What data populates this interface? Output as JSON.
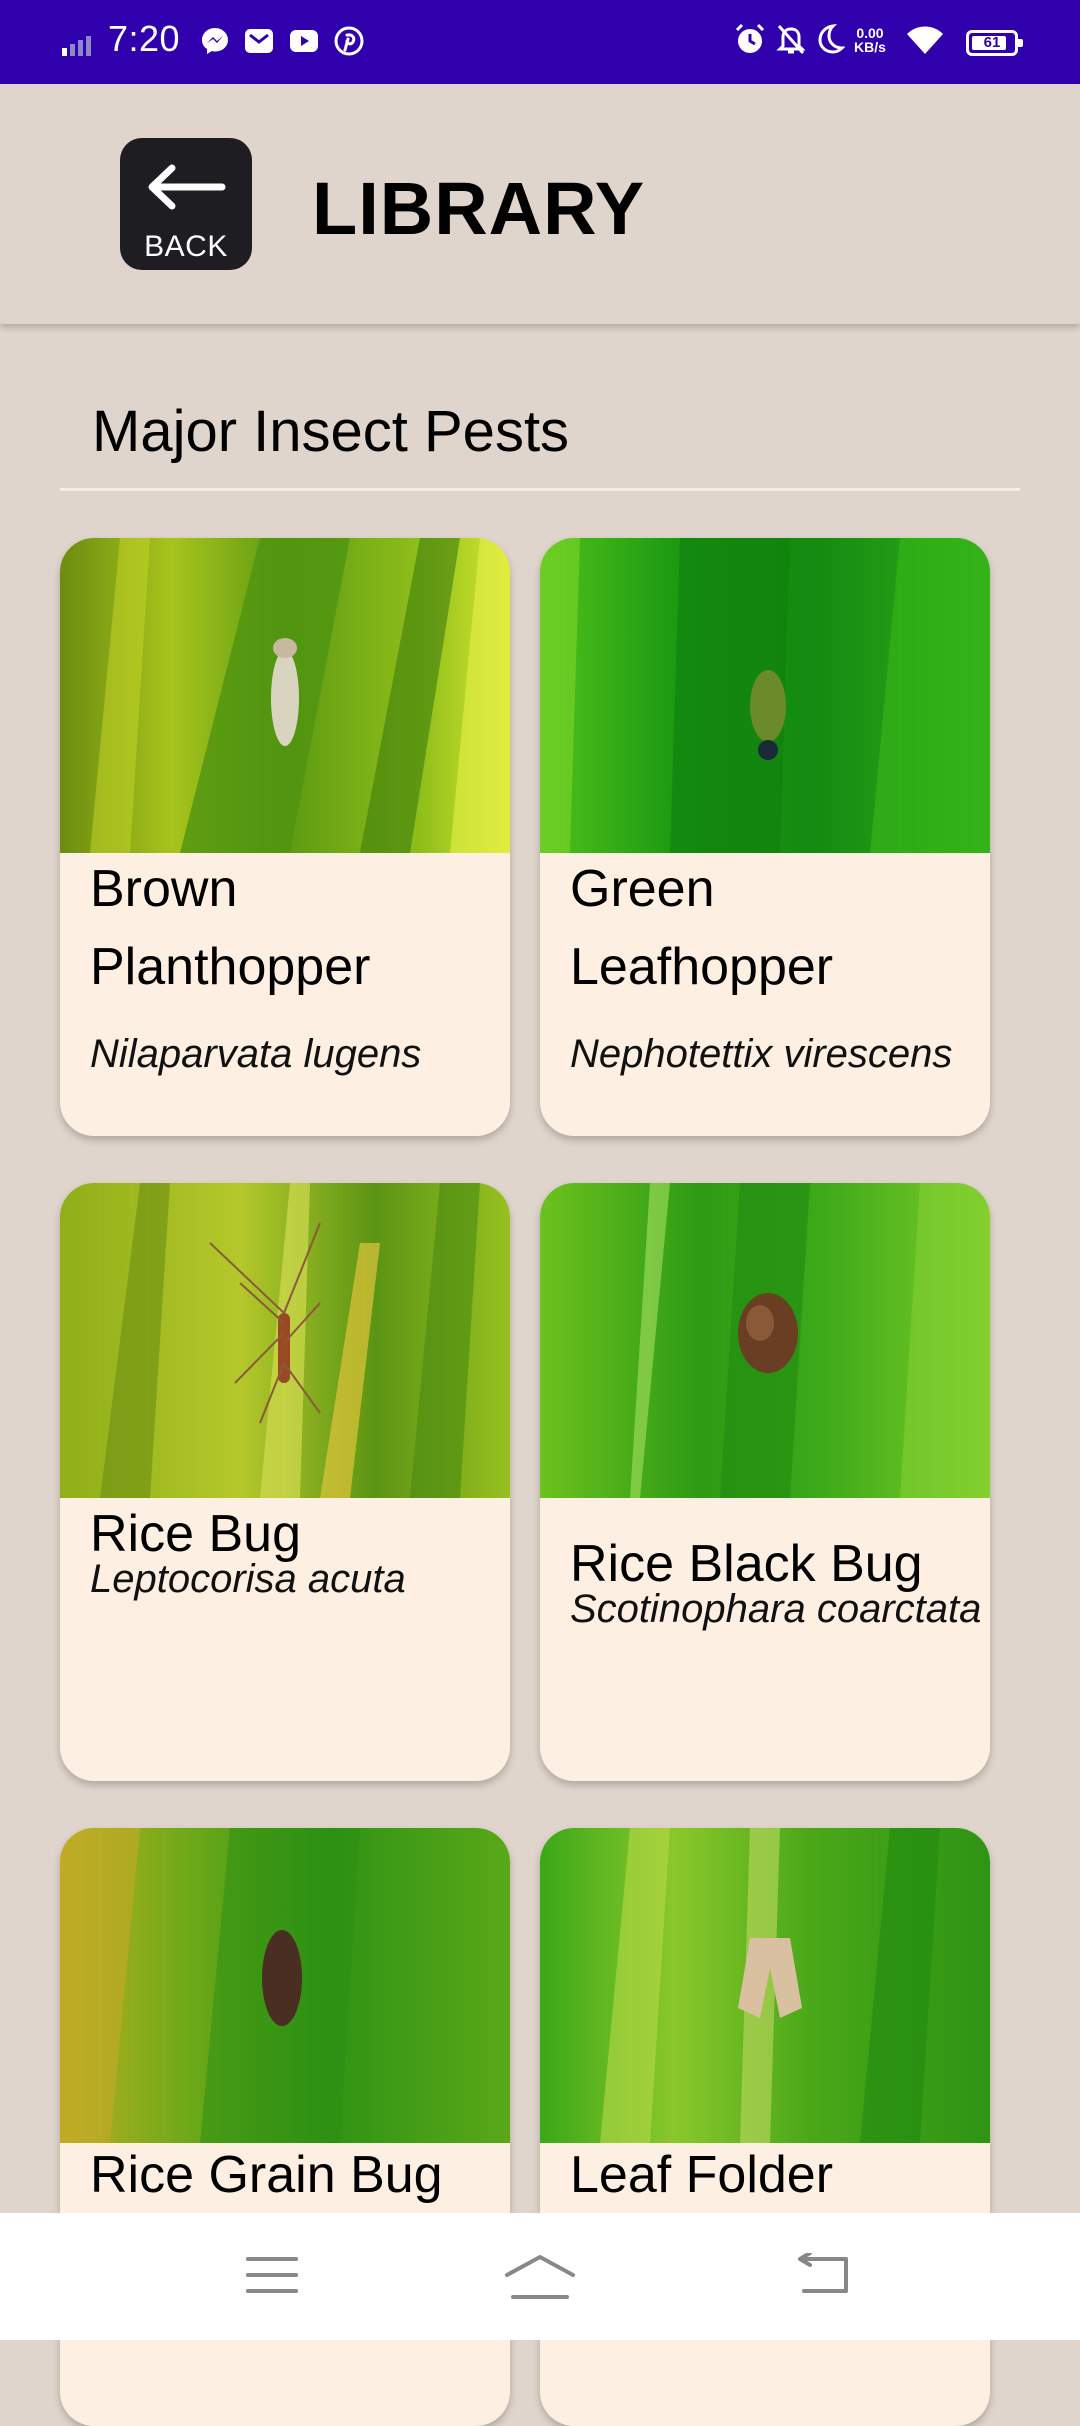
{
  "status_bar": {
    "time": "7:20",
    "net_speed_value": "0.00",
    "net_speed_unit": "KB/s",
    "battery": "61",
    "background": "#3000ad"
  },
  "header": {
    "back_label": "BACK",
    "title": "LIBRARY"
  },
  "section": {
    "title": "Major Insect Pests"
  },
  "pests": [
    {
      "name_line1": "Brown",
      "name_line2": "Planthopper",
      "scientific": "Nilaparvata lugens"
    },
    {
      "name_line1": "Green",
      "name_line2": "Leafhopper",
      "scientific": "Nephotettix virescens"
    },
    {
      "name_line1": "Rice Bug",
      "scientific": "Leptocorisa acuta"
    },
    {
      "name_line1": "Rice Black Bug",
      "scientific": "Scotinophara coarctata"
    },
    {
      "name_line1": "Rice Grain Bug"
    },
    {
      "name_line1": "Leaf Folder"
    }
  ],
  "navbar": {
    "icons": [
      "menu-icon",
      "home-icon",
      "back-icon"
    ]
  }
}
